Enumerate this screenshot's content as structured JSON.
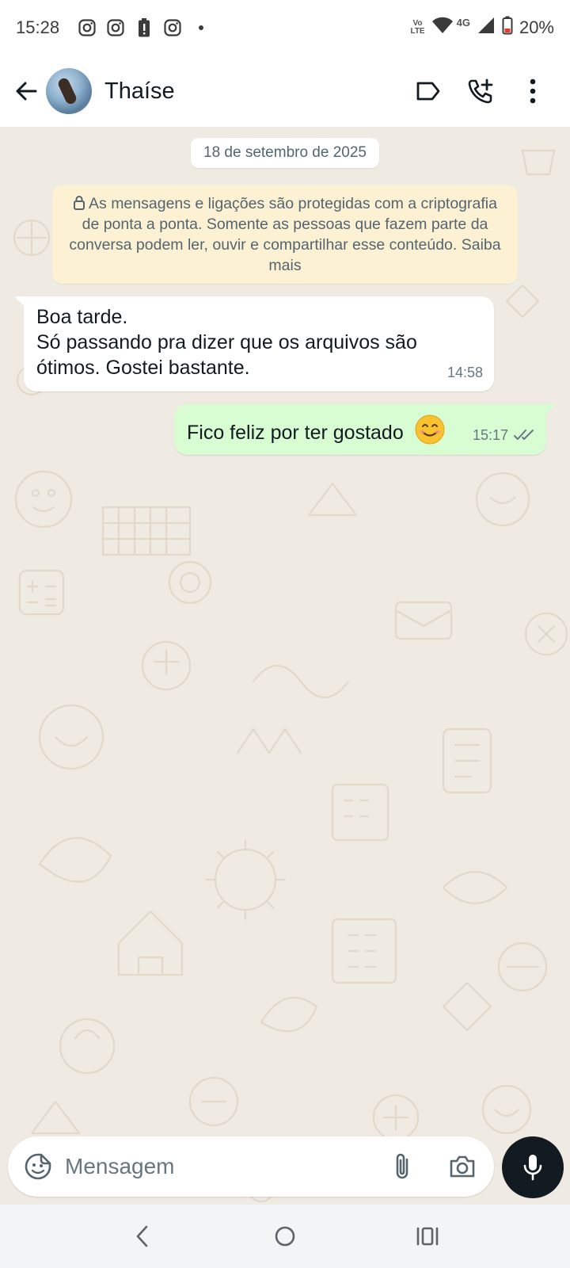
{
  "status_bar": {
    "time": "15:28",
    "notification_icons": [
      "instagram-icon",
      "instagram-icon",
      "battery-alert-icon",
      "instagram-icon",
      "dot-icon"
    ],
    "volte_line1": "Vo",
    "volte_line2": "LTE",
    "network": "4G",
    "battery": "20%"
  },
  "header": {
    "contact_name": "Thaíse",
    "actions": [
      "label-icon",
      "add-call-icon",
      "more-vert-icon"
    ]
  },
  "chat": {
    "date_chip": "18 de setembro de 2025",
    "encryption_notice": "As mensagens e ligações são protegidas com a criptografia de ponta a ponta. Somente as pessoas que fazem parte da conversa podem ler, ouvir e compartilhar esse conteúdo. Saiba mais",
    "messages": [
      {
        "direction": "incoming",
        "lines": [
          "Boa tarde.",
          "Só passando pra dizer que os arquivos são ótimos. Gostei bastante."
        ],
        "time": "14:58"
      },
      {
        "direction": "outgoing",
        "text": "Fico feliz por ter gostado",
        "emoji": "smiling-face-icon",
        "time": "15:17",
        "status": "read"
      }
    ]
  },
  "composer": {
    "placeholder": "Mensagem",
    "icons": [
      "sticker-icon",
      "attach-icon",
      "camera-icon",
      "mic-icon"
    ]
  },
  "nav_bar": [
    "back-nav-icon",
    "home-nav-icon",
    "recents-nav-icon"
  ],
  "colors": {
    "chat_background": "#efeae2",
    "outgoing_bubble": "#d9fdd3",
    "incoming_bubble": "#ffffff",
    "encryption_notice_bg": "#fdf1d4",
    "mic_button": "#111b21",
    "read_ticks": "#667781"
  }
}
